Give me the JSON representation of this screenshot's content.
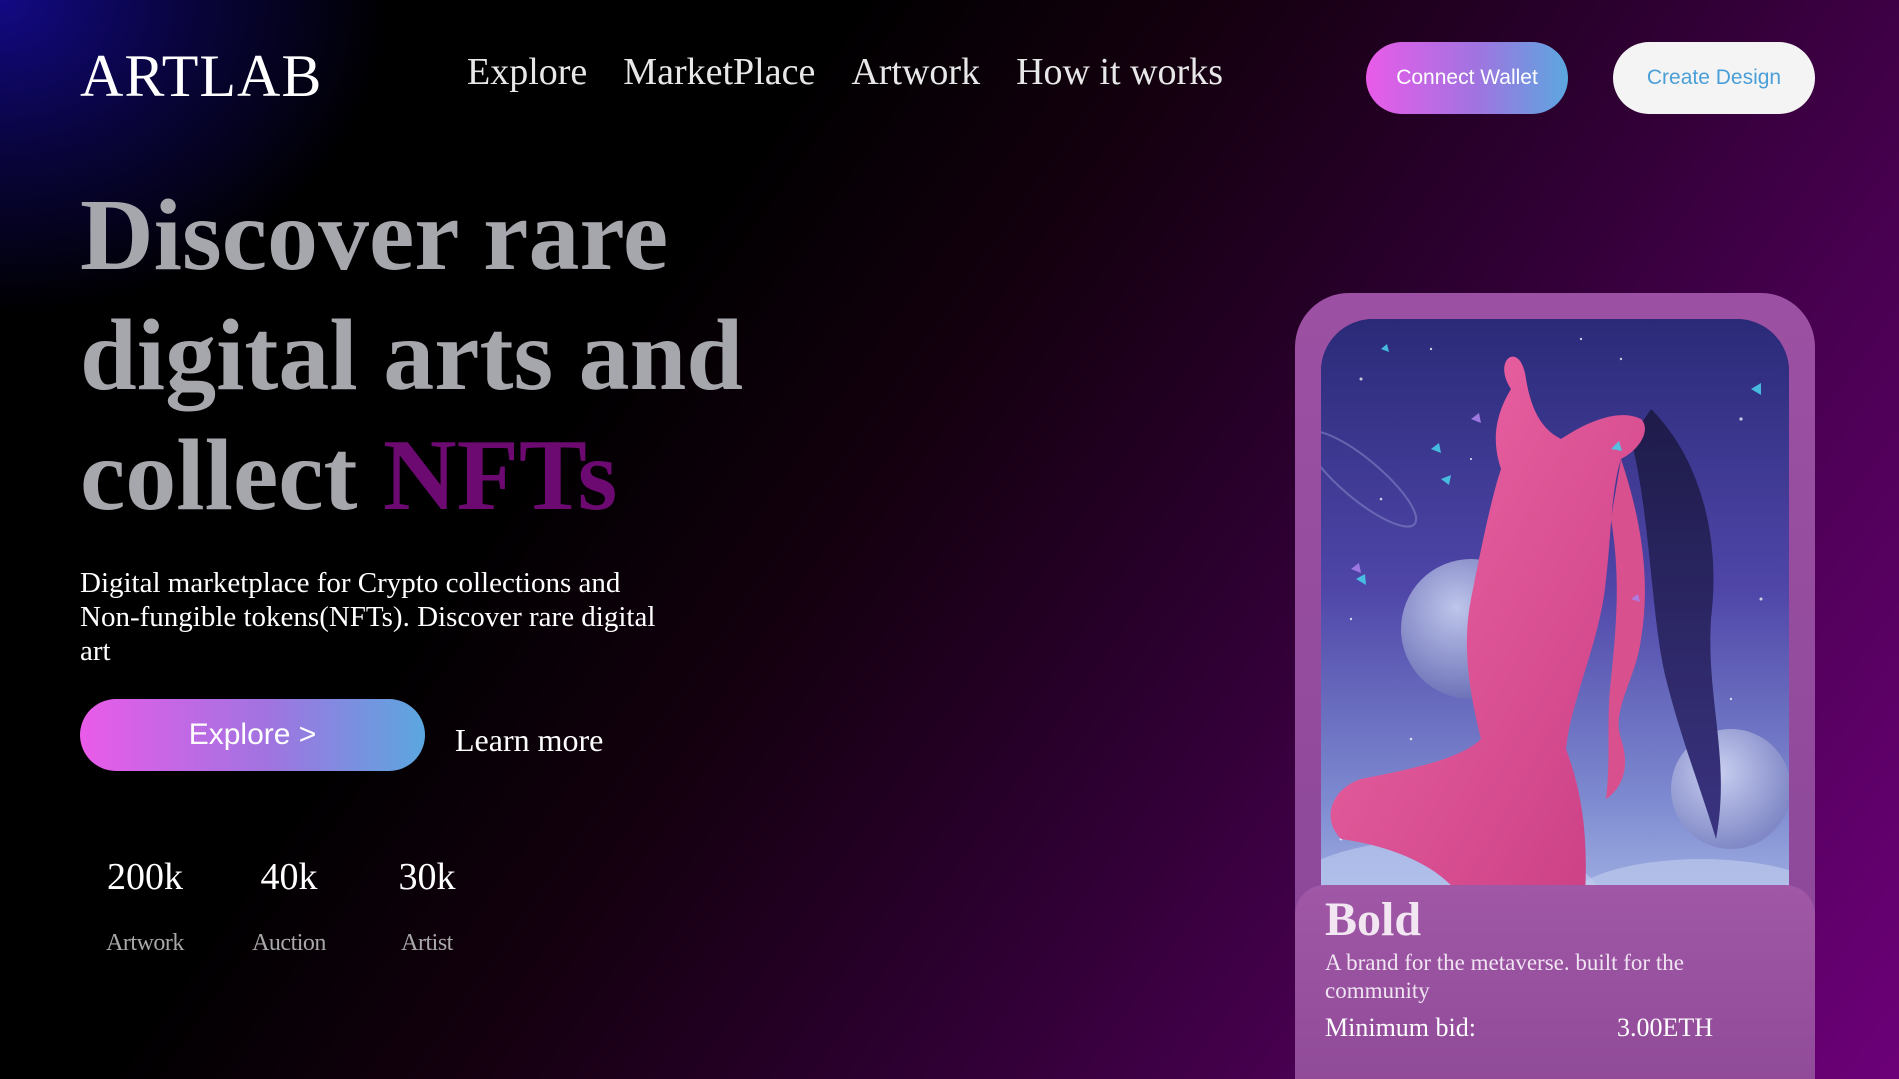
{
  "nav": {
    "logo": "ARTLAB",
    "links": [
      "Explore",
      "MarketPlace",
      "Artwork",
      "How it works"
    ],
    "connect_wallet": "Connect Wallet",
    "create_design": "Create Design"
  },
  "hero": {
    "title_part1": "Discover rare",
    "title_part2": "digital arts and",
    "title_part3": "collect ",
    "title_accent": "NFTs",
    "subtitle": "Digital marketplace for Crypto collections and Non-fungible tokens(NFTs). Discover rare digital art",
    "explore_button": "Explore >",
    "learn_more": "Learn more"
  },
  "stats": [
    {
      "value": "200k",
      "label": "Artwork"
    },
    {
      "value": "40k",
      "label": "Auction"
    },
    {
      "value": "30k",
      "label": "Artist"
    }
  ],
  "card": {
    "name": "Bold",
    "description": "A brand for the metaverse. built for the community",
    "bid_label": "Minimum bid:",
    "bid_value": "3.00ETH"
  },
  "colors": {
    "accent_gradient_start": "#e95be9",
    "accent_gradient_end": "#5ba7df",
    "title_gray": "#a6a6ad",
    "nft_accent": "#6d0a72",
    "card_purple": "#9c50a3",
    "create_button_text": "#4a9fd8"
  }
}
